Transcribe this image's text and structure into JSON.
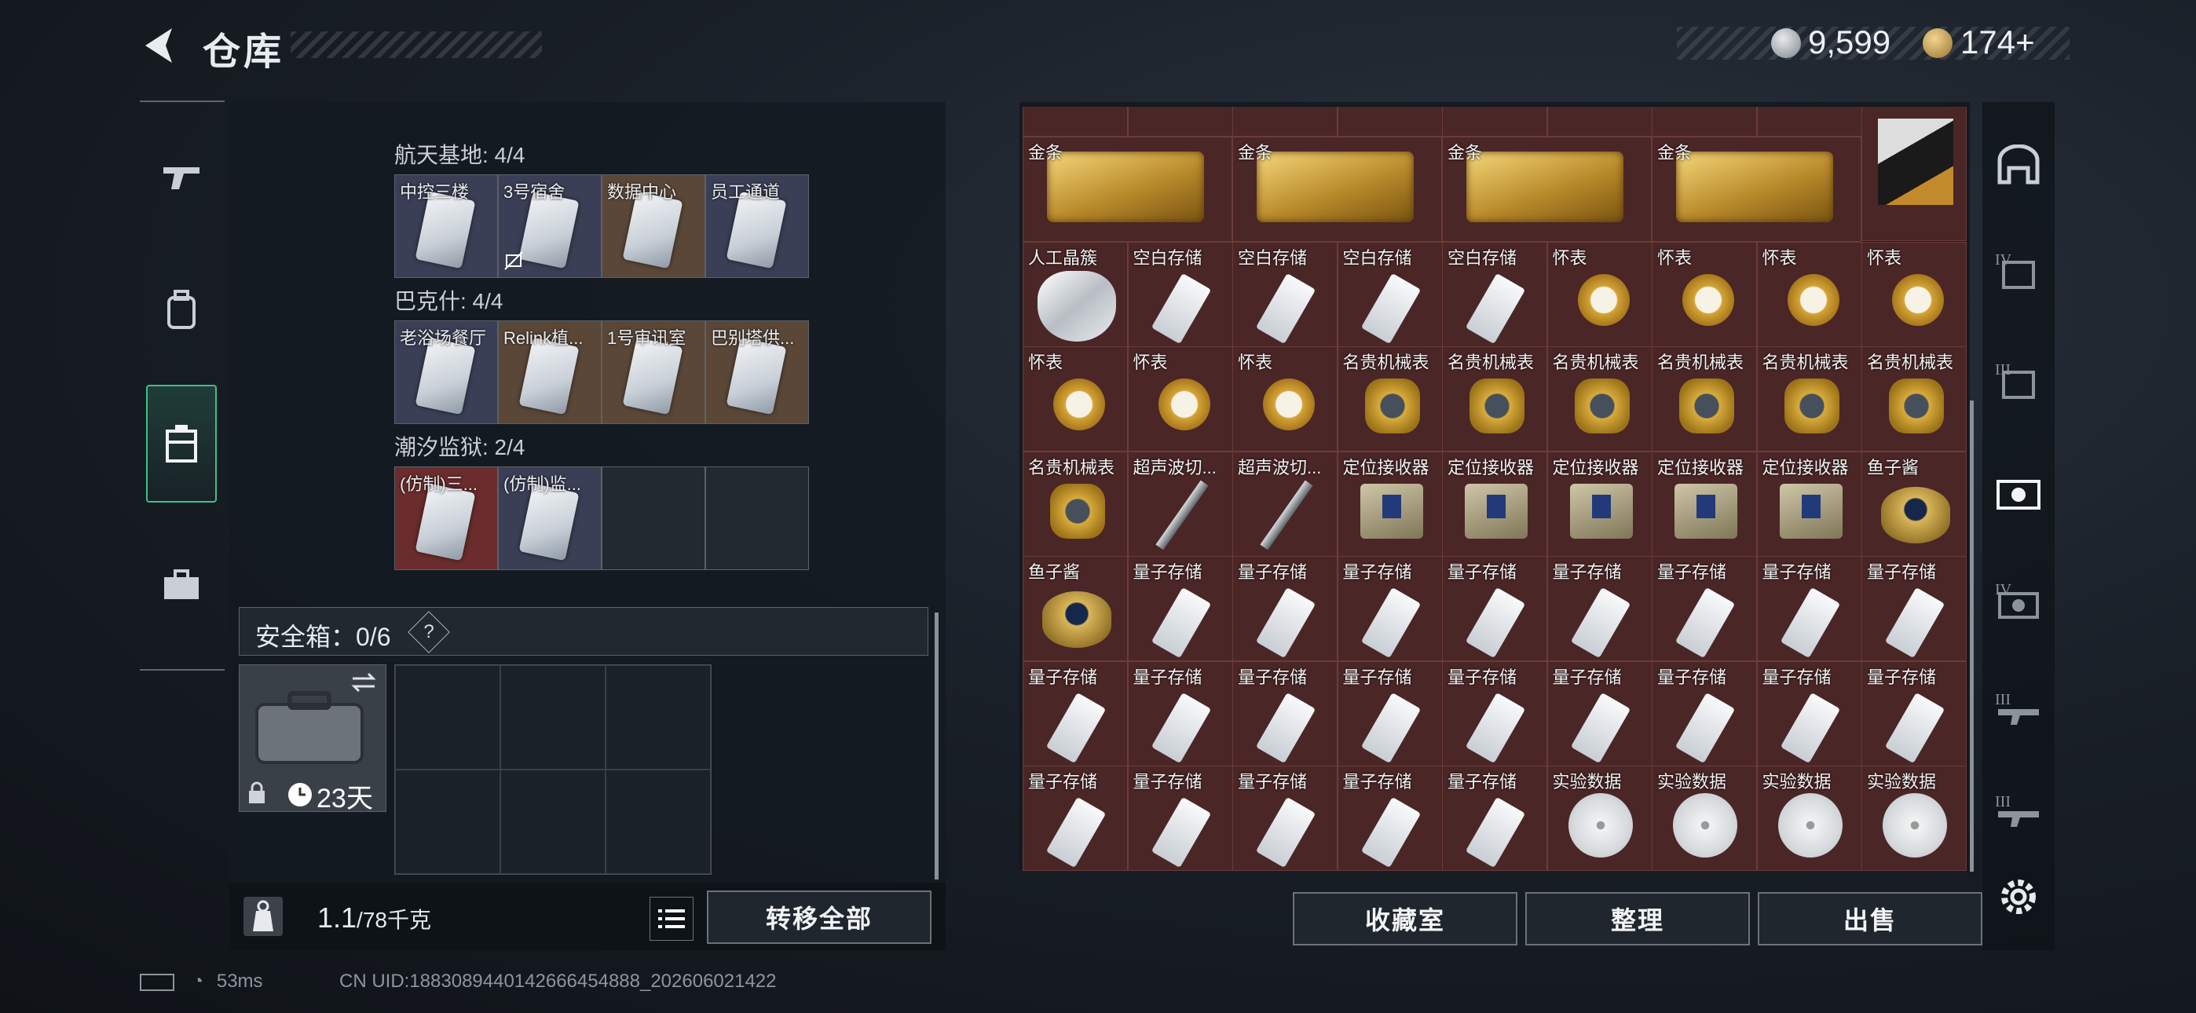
{
  "header": {
    "title": "仓库"
  },
  "currency": {
    "silver": "9,599",
    "gold": "174+"
  },
  "left": {
    "sections": [
      {
        "title": "航天基地: 4/4",
        "slots": [
          {
            "label": "中控三楼",
            "bg": "blue"
          },
          {
            "label": "3号宿舍",
            "bg": "blue"
          },
          {
            "label": "数据中心",
            "bg": "brown"
          },
          {
            "label": "员工通道",
            "bg": "blue"
          }
        ]
      },
      {
        "title": "巴克什: 4/4",
        "slots": [
          {
            "label": "老浴场餐厅",
            "bg": "blue"
          },
          {
            "label": "Relink植...",
            "bg": "brown"
          },
          {
            "label": "1号审讯室",
            "bg": "brown"
          },
          {
            "label": "巴别塔供...",
            "bg": "brown"
          }
        ]
      },
      {
        "title": "潮汐监狱: 2/4",
        "slots": [
          {
            "label": "(仿制)三...",
            "bg": "red"
          },
          {
            "label": "(仿制)监...",
            "bg": "blue"
          },
          {
            "label": "",
            "bg": "empty"
          },
          {
            "label": "",
            "bg": "empty"
          }
        ]
      }
    ],
    "safe_box": {
      "label": "安全箱：0/6",
      "help": "?",
      "days": "23天"
    },
    "weight": {
      "value": "1.1",
      "max": "/78千克"
    },
    "transfer_all": "转移全部"
  },
  "grid": {
    "row0": [
      "金条",
      "金条",
      "金条",
      "金条"
    ],
    "rows": [
      [
        "人工晶簇",
        "空白存储",
        "空白存储",
        "空白存储",
        "空白存储",
        "怀表",
        "怀表",
        "怀表",
        "怀表"
      ],
      [
        "怀表",
        "怀表",
        "怀表",
        "名贵机械表",
        "名贵机械表",
        "名贵机械表",
        "名贵机械表",
        "名贵机械表",
        "名贵机械表"
      ],
      [
        "名贵机械表",
        "超声波切...",
        "超声波切...",
        "定位接收器",
        "定位接收器",
        "定位接收器",
        "定位接收器",
        "定位接收器",
        "鱼子酱"
      ],
      [
        "鱼子酱",
        "量子存储",
        "量子存储",
        "量子存储",
        "量子存储",
        "量子存储",
        "量子存储",
        "量子存储",
        "量子存储"
      ],
      [
        "量子存储",
        "量子存储",
        "量子存储",
        "量子存储",
        "量子存储",
        "量子存储",
        "量子存储",
        "量子存储",
        "量子存储"
      ],
      [
        "量子存储",
        "量子存储",
        "量子存储",
        "量子存储",
        "量子存储",
        "实验数据",
        "实验数据",
        "实验数据",
        "实验数据"
      ]
    ]
  },
  "buttons": {
    "collection": "收藏室",
    "sort": "整理",
    "sell": "出售"
  },
  "right_nav": [
    "",
    "IV",
    "III",
    "",
    "IV",
    "III",
    "III"
  ],
  "status": {
    "ping": "53ms",
    "uid": "CN UID:1883089440142666454888_202606021422"
  },
  "colors": {
    "accent": "#3fbf8a",
    "cell_bg": "#4b2627"
  }
}
